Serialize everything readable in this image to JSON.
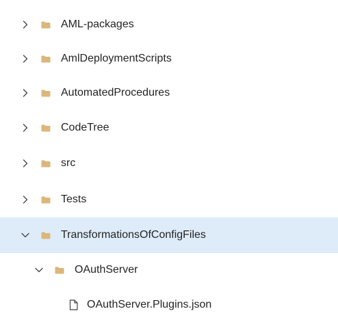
{
  "colors": {
    "selected_row_bg": "#deecf9",
    "folder": "#dcb67a",
    "chevron": "#424242",
    "text": "#242424"
  },
  "tree": {
    "items": [
      {
        "label": "AML-packages",
        "type": "folder",
        "level": 0,
        "expanded": false,
        "selected": false,
        "icon": "folder-icon"
      },
      {
        "label": "AmlDeploymentScripts",
        "type": "folder",
        "level": 0,
        "expanded": false,
        "selected": false,
        "icon": "folder-icon"
      },
      {
        "label": "AutomatedProcedures",
        "type": "folder",
        "level": 0,
        "expanded": false,
        "selected": false,
        "icon": "folder-icon"
      },
      {
        "label": "CodeTree",
        "type": "folder",
        "level": 0,
        "expanded": false,
        "selected": false,
        "icon": "folder-icon"
      },
      {
        "label": "src",
        "type": "folder",
        "level": 0,
        "expanded": false,
        "selected": false,
        "icon": "folder-icon"
      },
      {
        "label": "Tests",
        "type": "folder",
        "level": 0,
        "expanded": false,
        "selected": false,
        "icon": "folder-icon"
      },
      {
        "label": "TransformationsOfConfigFiles",
        "type": "folder",
        "level": 0,
        "expanded": true,
        "selected": true,
        "icon": "folder-icon"
      },
      {
        "label": "OAuthServer",
        "type": "folder",
        "level": 1,
        "expanded": true,
        "selected": false,
        "icon": "folder-icon"
      },
      {
        "label": "OAuthServer.Plugins.json",
        "type": "file",
        "level": 2,
        "selected": false,
        "icon": "file-icon"
      }
    ]
  }
}
